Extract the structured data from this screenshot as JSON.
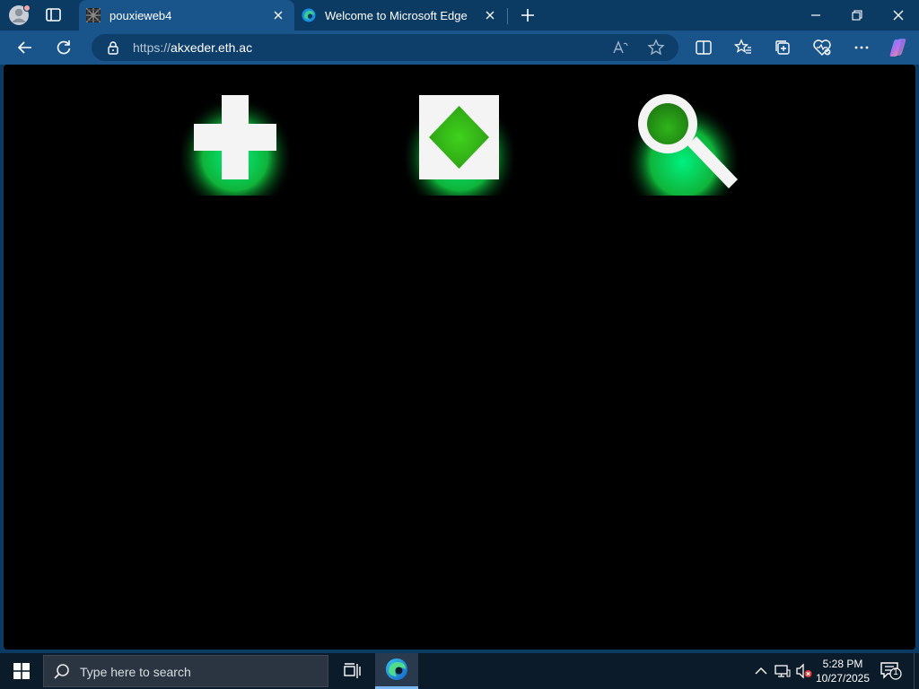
{
  "browser": {
    "tabs": [
      {
        "title": "pouxieweb4",
        "active": true,
        "favicon": "pattern-favicon"
      },
      {
        "title": "Welcome to Microsoft Edge",
        "active": false,
        "favicon": "edge-icon"
      }
    ],
    "address": {
      "protocol": "https://",
      "host": "akxeder.eth.ac"
    }
  },
  "page": {
    "background": "#000000",
    "glow_color": "#00e27a",
    "icons": [
      "plus-icon",
      "diamond-icon",
      "magnifier-icon"
    ]
  },
  "taskbar": {
    "search_placeholder": "Type here to search",
    "time": "5:28 PM",
    "date": "10/27/2025",
    "notification_count": "1"
  },
  "colors": {
    "titlebar": "#0b3a63",
    "toolbar": "#19558a",
    "taskbar": "#0c1b2a",
    "accent": "#78b7f3"
  }
}
